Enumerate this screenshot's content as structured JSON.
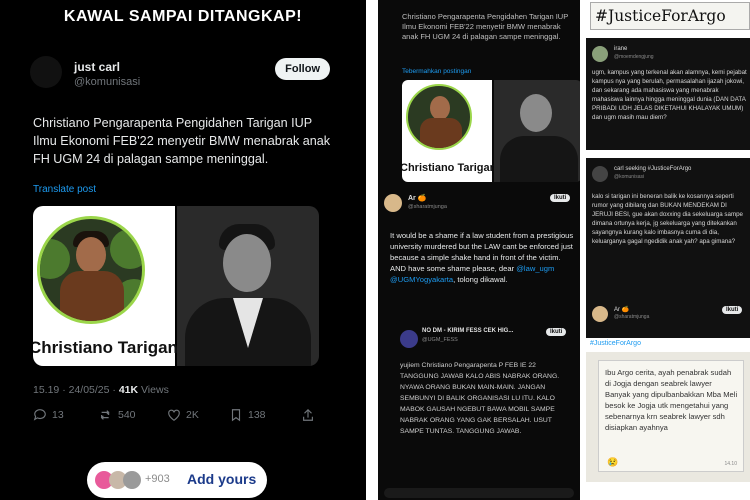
{
  "left": {
    "banner": "KAWAL SAMPAI DITANGKAP!",
    "user": {
      "name": "just carl",
      "handle": "@komunisasi",
      "follow": "Follow"
    },
    "tweet": "Christiano Pengarapenta Pengidahen Tarigan IUP Ilmu Ekonomi FEB'22 menyetir BMW menabrak anak FH UGM 24 di palagan sampe meninggal.",
    "translate": "Translate post",
    "media_caption": "Christiano Tarigan",
    "meta_time": "15.19 · 24/05/25 · ",
    "meta_views_num": "41K",
    "meta_views_label": " Views",
    "actions": {
      "replies": "13",
      "reposts": "540",
      "likes": "2K",
      "bookmarks": "138"
    },
    "add_yours": {
      "count": "+903",
      "label": "Add yours"
    }
  },
  "middle": {
    "text1": "Christiano Pengarapenta Pengidahen Tarigan IUP Ilmu Ekonomi FEB'22 menyetir BMW menabrak anak FH UGM 24 di palagan sampe meninggal.",
    "translate": "Tebermahkan postingan",
    "media_caption": "Christiano Tarigan",
    "reply": {
      "name": "Ar 🍊",
      "handle": "@sharatmjunga",
      "follow": "Ikuti",
      "text_a": "It would be a shame if a law student from a prestigious university murdered but the LAW cant be enforced just because a simple shake hand in front of the victim. AND have some shame please, dear ",
      "link1": "@law_ugm",
      "link2": "@UGMYogyakarta",
      "text_b": ", tolong dikawal."
    },
    "quote": {
      "name": "NO DM - KIRIM FESS CEK HIG...",
      "handle": "@UGM_FESS",
      "follow": "Ikuti",
      "text": "yujiem Christiano Pengarapenta P FEB IE 22 TANGGUNG JAWAB KALO ABIS NABRAK ORANG. NYAWA ORANG BUKAN MAIN-MAIN. JANGAN SEMBUNYI DI BALIK ORGANISASI LU ITU. KALO MABOK GAUSAH NGEBUT BAWA MOBIL SAMPE NABRAK ORANG YANG GAK BERSALAH. USUT SAMPE TUNTAS. TANGGUNG JAWAB."
    }
  },
  "right": {
    "hashtag": "#JusticeForArgo",
    "card1": {
      "name": "irane",
      "handle": "@moemdengjung",
      "text": "ugm, kampus yang terkenal akan alamnya, kemi pejabat kampus nya yang berulah, permasalahan ijazah jokowi, dan sekarang ada mahasiswa yang menabrak mahasiswa lainnya hingga meninggal dunia (DAN DATA PRIBADI UDH JELAS DIKETAHUI KHALAYAK UMUM) dan ugm masih mau diem?"
    },
    "card2": {
      "name": "carl seeking #JusticeForArgo",
      "handle": "@komunisasi",
      "text": "kalo si tarigan ini beneran balik ke kosannya seperti rumor yang dibilang dan BUKAN MENDEKAM DI JERUJI BESI, gue akan doxxing dia sekeluarga sampe dimana ortunya kerja, jg sekeluarga yang ditekankan sayangnya kurang kalo imbasnya cuma di dia, keluarganya gagal ngedidik anak yah? apa gimana?"
    },
    "card3": {
      "name": "Ar 🍊",
      "handle": "@sharatmjunga",
      "follow": "Ikuti"
    },
    "tag": "#JusticeForArgo",
    "note": {
      "text": "Ibu Argo cerita, ayah penabrak sudah di Jogja dengan seabrek lawyer Banyak yang dipulbanbakkan Mba Meli besok ke Jogja utk mengetahui yang sebenarnya krn seabrek lawyer sdh disiapkan ayahnya",
      "emoji": "😢",
      "time": "14.10"
    }
  }
}
